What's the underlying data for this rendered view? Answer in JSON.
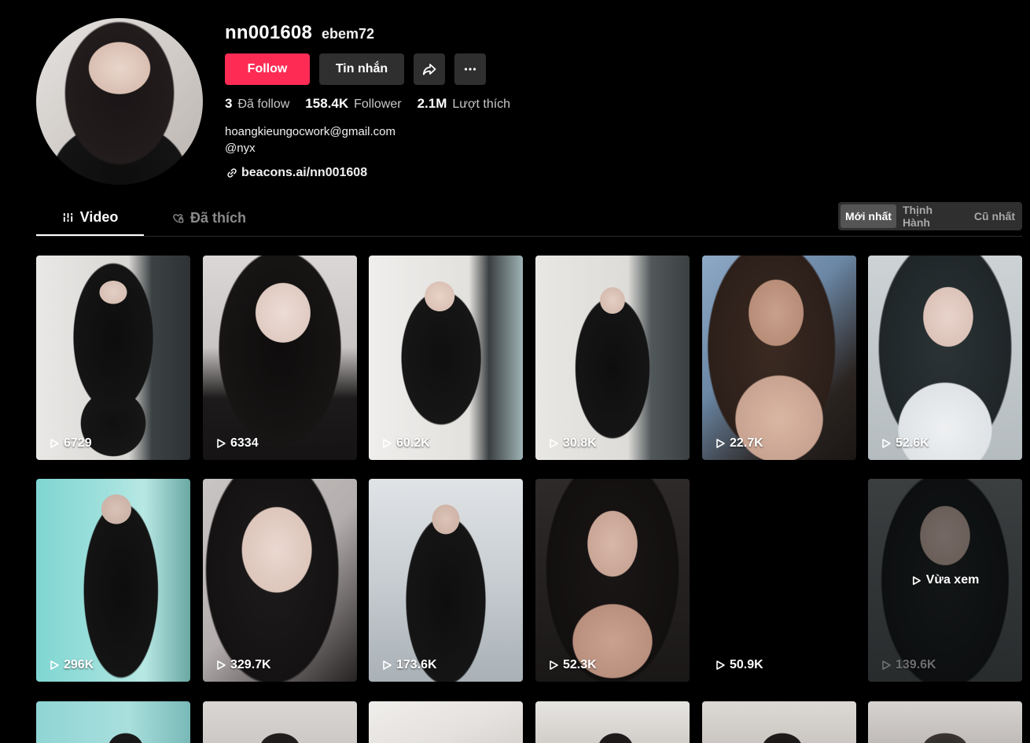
{
  "profile": {
    "username": "nn001608",
    "nickname": "ebem72",
    "bio_line1": "hoangkieungocwork@gmail.com",
    "bio_line2": "@nyx",
    "link": "beacons.ai/nn001608"
  },
  "actions": {
    "follow_label": "Follow",
    "message_label": "Tin nhắn"
  },
  "stats": {
    "following_count": "3",
    "following_label": "Đã follow",
    "followers_count": "158.4K",
    "followers_label": "Follower",
    "likes_count": "2.1M",
    "likes_label": "Lượt thích"
  },
  "tabs": {
    "video": "Video",
    "liked": "Đã thích"
  },
  "sort": {
    "latest": "Mới nhất",
    "popular": "Thịnh Hành",
    "oldest": "Cũ nhất"
  },
  "videos": [
    {
      "views": "6729"
    },
    {
      "views": "6334"
    },
    {
      "views": "60.2K"
    },
    {
      "views": "30.8K"
    },
    {
      "views": "22.7K"
    },
    {
      "views": "52.6K"
    },
    {
      "views": "296K"
    },
    {
      "views": "329.7K"
    },
    {
      "views": "173.6K"
    },
    {
      "views": "52.3K"
    },
    {
      "views": "50.9K"
    },
    {
      "views": "139.6K",
      "overlay": "Vừa xem"
    }
  ],
  "colors": {
    "accent": "#fe2c55",
    "background": "#000000",
    "button_dark": "#2f2f2f"
  }
}
